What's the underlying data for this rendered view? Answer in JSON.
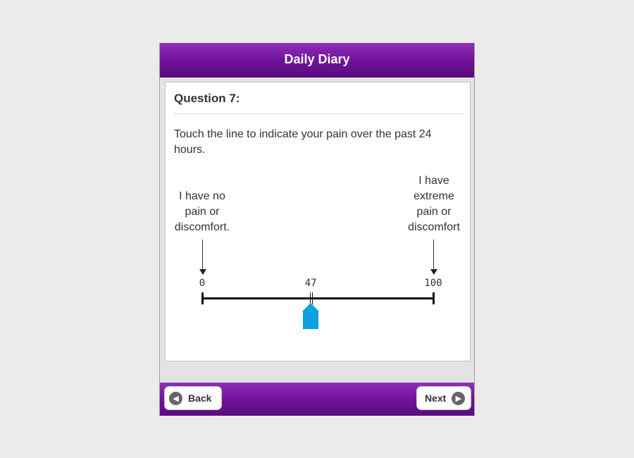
{
  "header": {
    "title": "Daily Diary"
  },
  "question": {
    "title": "Question 7:",
    "prompt": "Touch the line to indicate your pain over the past 24 hours."
  },
  "scale": {
    "min_label": "0",
    "max_label": "100",
    "current_value": "47",
    "value_fraction": 0.47,
    "left_anchor": [
      "I have no",
      "pain or",
      "discomfort."
    ],
    "right_anchor": [
      "I have",
      "extreme",
      "pain or",
      "discomfort"
    ],
    "pointer_color": "#0aa3e0"
  },
  "footer": {
    "back_label": "Back",
    "next_label": "Next"
  },
  "icons": {
    "back": "chevron-left-icon",
    "next": "chevron-right-icon"
  },
  "colors": {
    "accent": "#6e1296",
    "background": "#ebebeb"
  }
}
